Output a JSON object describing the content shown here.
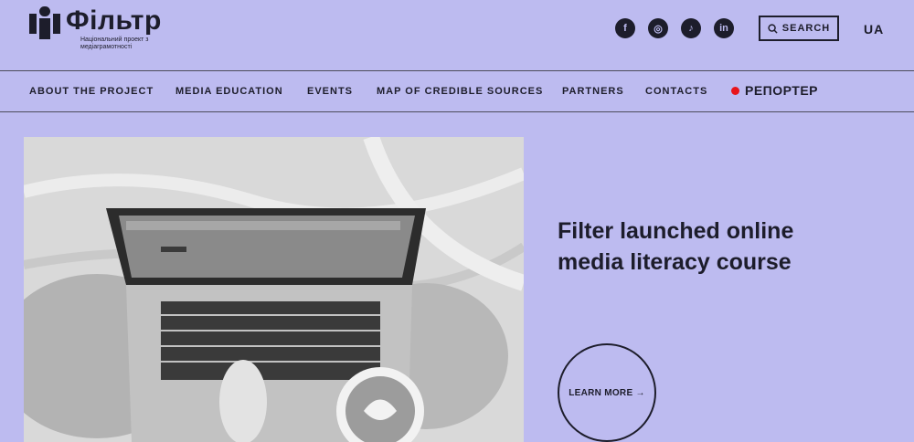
{
  "header": {
    "logo_word": "Фільтр",
    "logo_subtitle": "Національний проект з медіаграмотності",
    "socials": [
      {
        "name": "facebook",
        "glyph": "f"
      },
      {
        "name": "instagram",
        "glyph": "◎"
      },
      {
        "name": "tiktok",
        "glyph": "♪"
      },
      {
        "name": "linkedin",
        "glyph": "in"
      }
    ],
    "search_label": "SEARCH",
    "language": "UA"
  },
  "nav": {
    "items": [
      "ABOUT THE PROJECT",
      "MEDIA EDUCATION",
      "EVENTS",
      "MAP OF CREDIBLE SOURCES",
      "PARTNERS",
      "CONTACTS"
    ],
    "reporter_label": "РЕПОРТЕР"
  },
  "hero": {
    "title": "Filter launched online media literacy course",
    "cta_label": "LEARN MORE →"
  },
  "colors": {
    "background": "#bdbbf0",
    "text": "#1d1d2b",
    "reporter_dot": "#e8141b"
  }
}
